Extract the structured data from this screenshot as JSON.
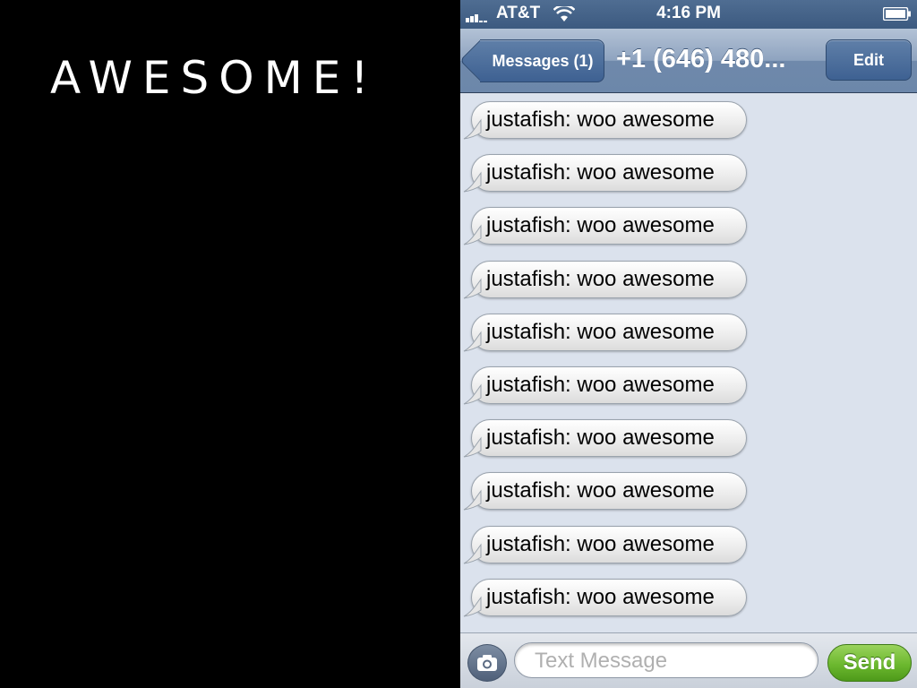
{
  "slide": {
    "title": "AWESOME!"
  },
  "status_bar": {
    "carrier": "AT&T",
    "time": "4:16 PM"
  },
  "nav_bar": {
    "back_label": "Messages (1)",
    "title": "+1 (646) 480...",
    "edit_label": "Edit"
  },
  "messages": [
    {
      "text": "justafish: woo awesome"
    },
    {
      "text": "justafish: woo awesome"
    },
    {
      "text": "justafish: woo awesome"
    },
    {
      "text": "justafish: woo awesome"
    },
    {
      "text": "justafish: woo awesome"
    },
    {
      "text": "justafish: woo awesome"
    },
    {
      "text": "justafish: woo awesome"
    },
    {
      "text": "justafish: woo awesome"
    },
    {
      "text": "justafish: woo awesome"
    },
    {
      "text": "justafish: woo awesome"
    }
  ],
  "input_bar": {
    "placeholder": "Text Message",
    "send_label": "Send"
  },
  "icons": [
    "signal-icon",
    "wifi-icon",
    "battery-icon",
    "camera-icon",
    "chevron-left-icon"
  ],
  "colors": {
    "send_green": "#6cb82f",
    "nav_blue": "#6c87aa",
    "background": "#dbe2ed"
  }
}
